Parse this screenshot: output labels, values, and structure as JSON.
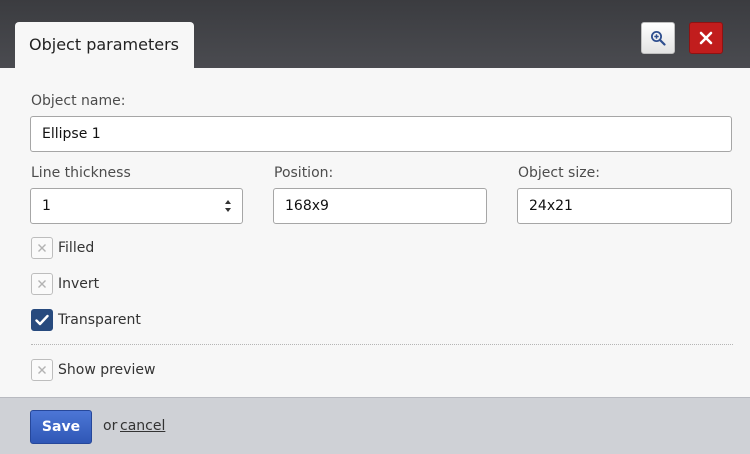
{
  "dialog": {
    "title": "Object parameters",
    "zoom_icon": "zoom-in-icon",
    "close_icon": "close-icon"
  },
  "form": {
    "object_name": {
      "label": "Object name:",
      "value": "Ellipse 1"
    },
    "line_thickness": {
      "label": "Line thickness",
      "value": "1"
    },
    "position": {
      "label": "Position:",
      "value": "168x9"
    },
    "object_size": {
      "label": "Object size:",
      "value": "24x21"
    },
    "checkboxes": [
      {
        "label": "Filled",
        "checked": false
      },
      {
        "label": "Invert",
        "checked": false
      },
      {
        "label": "Transparent",
        "checked": true
      }
    ],
    "show_preview": {
      "label": "Show preview",
      "checked": false
    }
  },
  "footer": {
    "save_label": "Save",
    "or_text": "or",
    "cancel_label": "cancel"
  },
  "colors": {
    "header": "#3b3c40",
    "close_button": "#c11d1d",
    "save_button": "#3a62c4",
    "checkbox_checked": "#274a7e"
  }
}
